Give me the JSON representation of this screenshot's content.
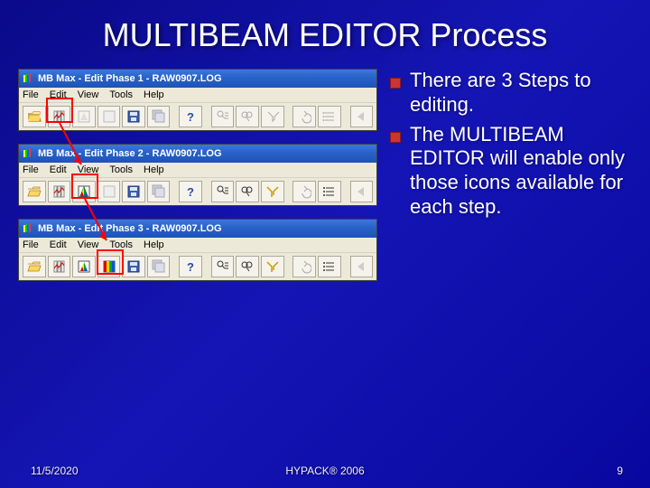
{
  "title": "MULTIBEAM EDITOR Process",
  "windows": [
    {
      "titlebar": "MB Max - Edit Phase 1 - RAW0907.LOG"
    },
    {
      "titlebar": "MB Max - Edit Phase 2 - RAW0907.LOG"
    },
    {
      "titlebar": "MB Max - Edit Phase 3 - RAW0907.LOG"
    }
  ],
  "menus": [
    "File",
    "Edit",
    "View",
    "Tools",
    "Help"
  ],
  "bullets": [
    "There are 3 Steps to editing.",
    "The MULTIBEAM EDITOR will enable only those icons available for each step."
  ],
  "footer": {
    "date": "11/5/2020",
    "center": "HYPACK® 2006",
    "page": "9"
  },
  "colors": {
    "highlight": "#ff0000",
    "bullet": "#cc3333"
  }
}
